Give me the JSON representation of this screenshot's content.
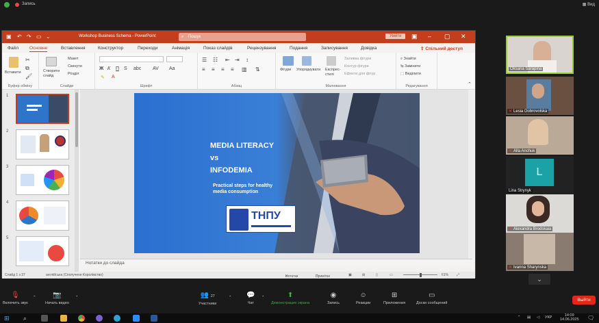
{
  "zoom": {
    "recording_label": "Запись",
    "view_label": "Вид",
    "leave_label": "Выйти",
    "toolbar": {
      "mute_label": "Включить звук",
      "video_label": "Начать видео",
      "participants_label": "Участники",
      "participants_count": "27",
      "chat_label": "Чат",
      "share_label": "Демонстрация экрана",
      "record_label": "Запись",
      "reactions_label": "Реакции",
      "apps_label": "Приложения",
      "whiteboard_label": "Доски сообщений"
    },
    "gallery": [
      {
        "name": "Oksana Sarapina",
        "muted": false,
        "speaking": true
      },
      {
        "name": "Lesia Dobrovolska",
        "muted": true
      },
      {
        "name": "Alla Anchuk",
        "muted": true
      },
      {
        "name": "Lina Strynyk",
        "muted": true,
        "avatar_letter": "L"
      },
      {
        "name": "Alexandra Brodskaia",
        "muted": true
      },
      {
        "name": "Ivanna Sharynska",
        "muted": true
      }
    ]
  },
  "ppt": {
    "doc_title": "Workshop Business Schema - PowerPoint",
    "search_placeholder": "Пошук",
    "signin_label": "Увійти",
    "menu": [
      "Файл",
      "Основне",
      "Вставлення",
      "Конструктор",
      "Переходи",
      "Анімація",
      "Показ слайдів",
      "Рецензування",
      "Подання",
      "Записування",
      "Довідка"
    ],
    "active_menu": "Основне",
    "share_label": "Спільний доступ",
    "ribbon": {
      "clipboard": {
        "group": "Буфер обміну",
        "paste": "Вставити"
      },
      "slides": {
        "group": "Слайди",
        "new_slide": "Створити слайд",
        "layout": "Макет",
        "reset": "Скинути",
        "section": "Розділ"
      },
      "font": {
        "group": "Шрифт"
      },
      "paragraph": {
        "group": "Абзац"
      },
      "drawing": {
        "group": "Малювання",
        "shapes": "Фігури",
        "arrange": "Упорядкувати",
        "quick_styles": "Експрес-стилі",
        "fill": "Заливка фігури",
        "outline": "Контур фігури",
        "effects": "Ефекти для фігур"
      },
      "editing": {
        "group": "Редагування",
        "find": "Знайти",
        "replace": "Замінити",
        "select": "Виділити"
      }
    },
    "slide_numbers": [
      "1",
      "2",
      "3",
      "4",
      "5"
    ],
    "notes_placeholder": "Нотатки до слайда",
    "status": {
      "slide_count": "Слайд 1 з 37",
      "language": "англійська (Сполучене Королівство)",
      "notes": "Нотатки",
      "comments": "Примітки",
      "zoom": "61%"
    },
    "slide": {
      "title_line1": "MEDIA LITERACY",
      "title_line2": "vs",
      "title_line3": "INFODEMIA",
      "subtitle": "Practical steps for healthy media consumption",
      "logo_text": "ТНПУ"
    }
  },
  "taskbar": {
    "time": "14:09",
    "date": "14.06.2025",
    "lang": "УКР"
  },
  "colors": {
    "ppt_accent": "#c43e1c",
    "leave_red": "#e0281c",
    "slide_blue": "#2e74c9",
    "speaker_border": "#9acd32"
  }
}
